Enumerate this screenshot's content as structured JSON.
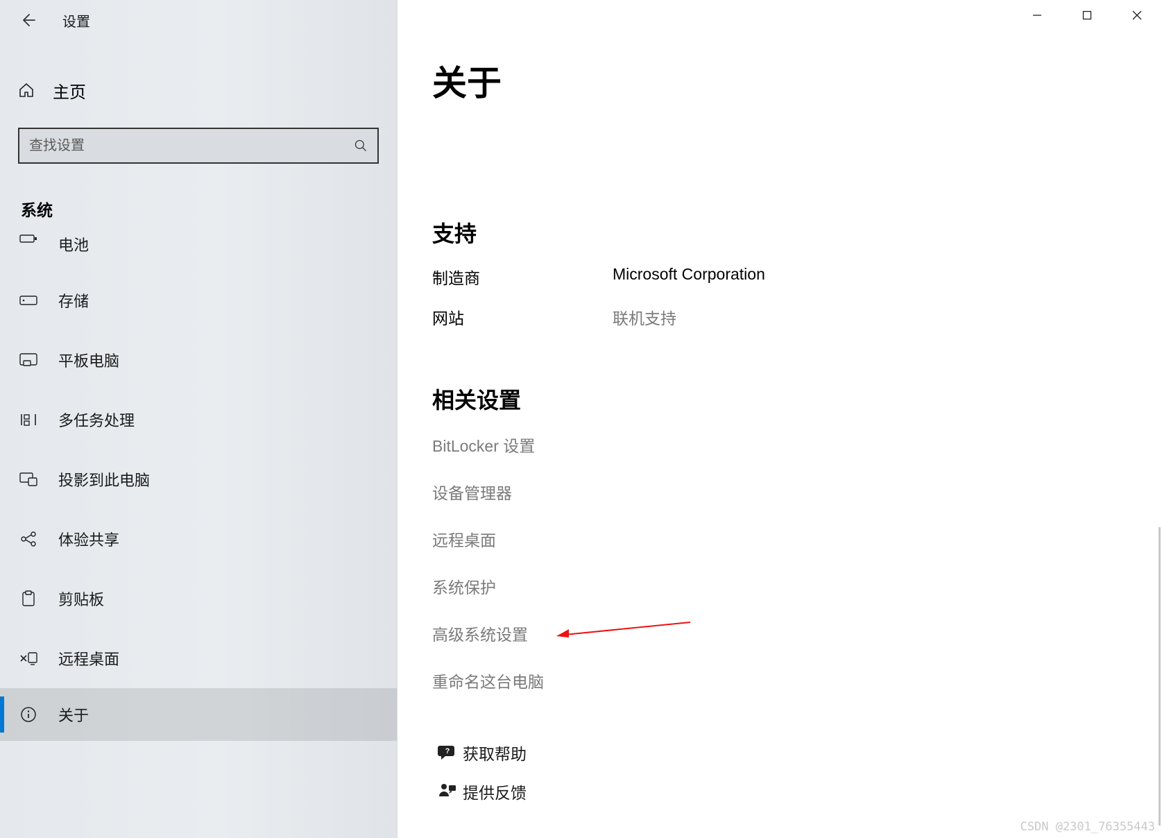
{
  "window": {
    "app_title": "设置"
  },
  "sidebar": {
    "home_label": "主页",
    "search_placeholder": "查找设置",
    "section_label": "系统",
    "items": [
      {
        "label": "电池",
        "icon": "battery-icon"
      },
      {
        "label": "存储",
        "icon": "storage-icon"
      },
      {
        "label": "平板电脑",
        "icon": "tablet-icon"
      },
      {
        "label": "多任务处理",
        "icon": "multitask-icon"
      },
      {
        "label": "投影到此电脑",
        "icon": "project-icon"
      },
      {
        "label": "体验共享",
        "icon": "share-icon"
      },
      {
        "label": "剪贴板",
        "icon": "clipboard-icon"
      },
      {
        "label": "远程桌面",
        "icon": "remote-desktop-icon"
      },
      {
        "label": "关于",
        "icon": "info-icon"
      }
    ]
  },
  "main": {
    "page_title": "关于",
    "support_heading": "支持",
    "support_rows": [
      {
        "k": "制造商",
        "v": "Microsoft Corporation",
        "link": false
      },
      {
        "k": "网站",
        "v": "联机支持",
        "link": true
      }
    ],
    "related_heading": "相关设置",
    "related_links": [
      "BitLocker 设置",
      "设备管理器",
      "远程桌面",
      "系统保护",
      "高级系统设置",
      "重命名这台电脑"
    ],
    "help_links": [
      {
        "label": "获取帮助",
        "icon": "help-chat-icon"
      },
      {
        "label": "提供反馈",
        "icon": "feedback-icon"
      }
    ]
  },
  "watermark": "CSDN @2301_76355443"
}
